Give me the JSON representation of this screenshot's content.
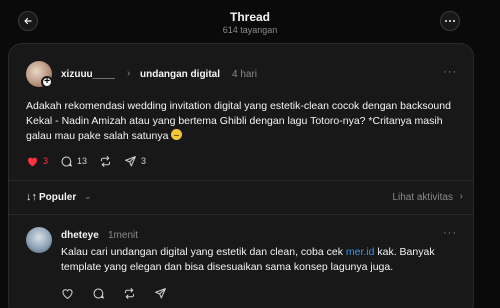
{
  "header": {
    "title": "Thread",
    "views": "614 tayangan"
  },
  "post": {
    "username": "xizuuu____",
    "topic": "undangan digital",
    "time": "4 hari",
    "text": "Adakah rekomendasi wedding invitation digital yang estetik-clean cocok dengan backsound Kekal - Nadin Amizah atau yang bertema Ghibli dengan lagu Totoro-nya? *Critanya masih galau mau pake salah satunya",
    "likes": "3",
    "comments": "13",
    "shares": "3"
  },
  "sort": {
    "label": "Populer",
    "activity": "Lihat aktivitas"
  },
  "reply": {
    "username": "dheteye",
    "time": "1menit",
    "text_before": "Kalau cari undangan digital yang estetik dan clean, coba cek ",
    "link": "mer.id",
    "text_after": " kak. Banyak template yang elegan dan bisa disesuaikan sama konsep lagunya juga."
  },
  "colors": {
    "like": "#ff3040",
    "link": "#3897f0",
    "background": "#0a0a0a",
    "card": "#181818"
  }
}
